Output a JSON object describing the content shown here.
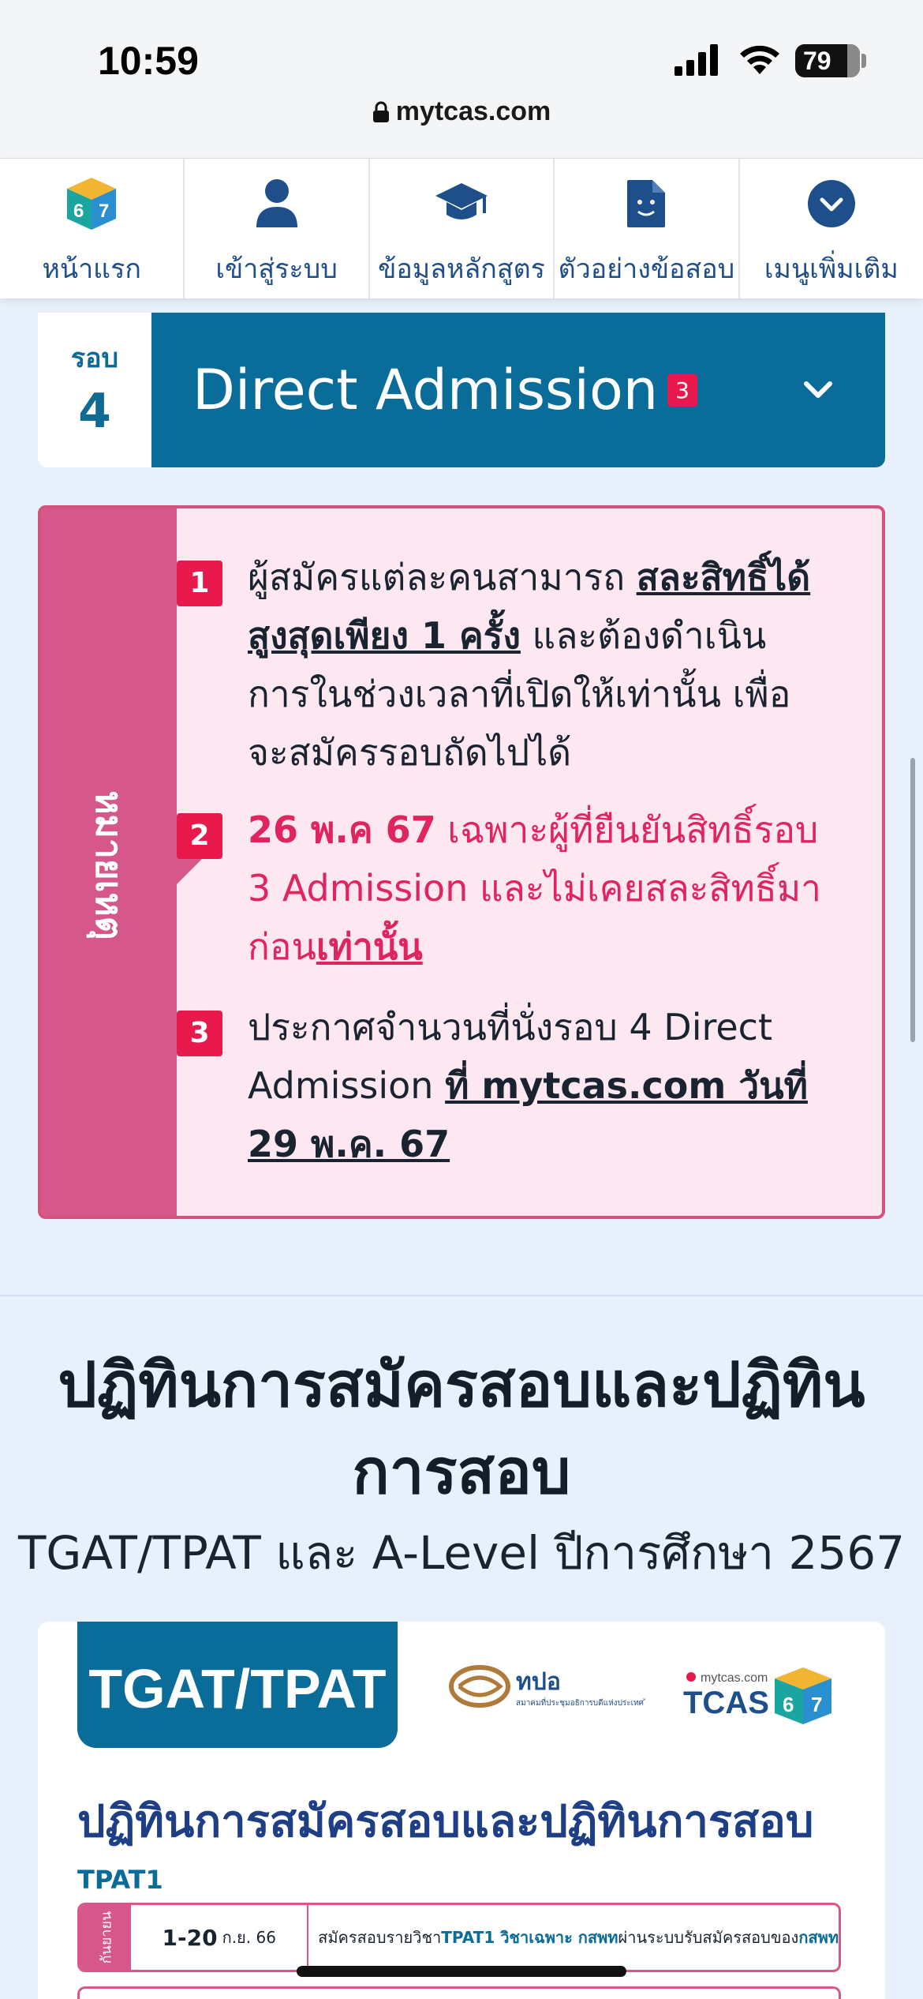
{
  "status_bar": {
    "time": "10:59",
    "battery": "79"
  },
  "browser": {
    "url": "mytcas.com"
  },
  "nav": {
    "items": [
      {
        "label": "หน้าแรก",
        "icon": "tcas67-cube-icon"
      },
      {
        "label": "เข้าสู่ระบบ",
        "icon": "user-icon"
      },
      {
        "label": "ข้อมูลหลักสูตร",
        "icon": "graduation-cap-icon"
      },
      {
        "label": "ตัวอย่างข้อสอบ",
        "icon": "document-face-icon"
      },
      {
        "label": "เมนูเพิ่มเติม",
        "icon": "chevron-down-circle-icon"
      }
    ]
  },
  "round": {
    "label_small": "รอบ",
    "label_number": "4",
    "title": "Direct Admission",
    "badge": "3"
  },
  "notes": {
    "label": "หมายเหตุ",
    "items": [
      {
        "num": "1",
        "text_a": "ผู้สมัครแต่ละคนสามารถ ",
        "text_b": "สละสิทธิ์ได้สูงสุดเพียง 1 ครั้ง",
        "text_c": " และต้องดำเนินการในช่วงเวลาที่เปิดให้เท่านั้น เพื่อจะสมัครรอบถัดไปได้"
      },
      {
        "num": "2",
        "text_a": "26 พ.ค 67",
        "text_b": " เฉพาะผู้ที่ยืนยันสิทธิ์รอบ 3 Admission และไม่เคยสละสิทธิ์มาก่อน",
        "text_c": "เท่านั้น"
      },
      {
        "num": "3",
        "text_a": "ประกาศจำนวนที่นั่งรอบ 4 Direct Admission ",
        "text_b": "ที่ mytcas.com วันที่ 29 พ.ค. 67"
      }
    ]
  },
  "section": {
    "title_line1": "ปฏิทินการสมัครสอบและปฏิทิน",
    "title_line2": "การสอบ",
    "subtitle": "TGAT/TPAT และ A-Level ปีการศึกษา 2567"
  },
  "poster": {
    "tab": "TGAT/TPAT",
    "hnao_text": "ทปอ",
    "hnao_sub": "สมาคมที่ประชุมอธิการบดีแห่งประเทศไทย",
    "tcas_site": "mytcas.com",
    "tcas_text": "TCAS",
    "title": "ปฏิทินการสมัครสอบและปฏิทินการสอบ",
    "tpat_label": "TPAT1",
    "row": {
      "month": "กันยายน",
      "date": "1-20",
      "date_suffix": "ก.ย. 66",
      "desc_a": "สมัครสอบรายวิชา ",
      "desc_b": "TPAT1 วิชาเฉพาะ กสพท",
      "desc_c": " ผ่านระบบรับสมัครสอบของ ",
      "desc_d": "กสพท"
    }
  },
  "colors": {
    "primary": "#0a6c98",
    "accent_pink": "#d6578a",
    "badge_red": "#e8194d",
    "nav_text": "#1f4f8a",
    "notes_bg": "#fde7f0",
    "page_bg": "#e8f1fb"
  }
}
